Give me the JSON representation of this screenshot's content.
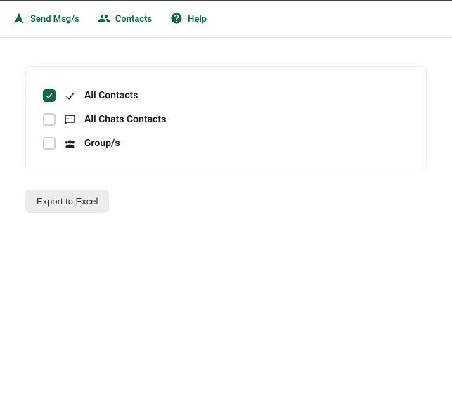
{
  "nav": {
    "send_msgs": "Send Msg/s",
    "contacts": "Contacts",
    "help": "Help"
  },
  "options": {
    "all_contacts": {
      "label": "All Contacts",
      "checked": true
    },
    "all_chats": {
      "label": "All Chats Contacts",
      "checked": false
    },
    "groups": {
      "label": "Group/s",
      "checked": false
    }
  },
  "actions": {
    "export_excel": "Export to Excel"
  }
}
